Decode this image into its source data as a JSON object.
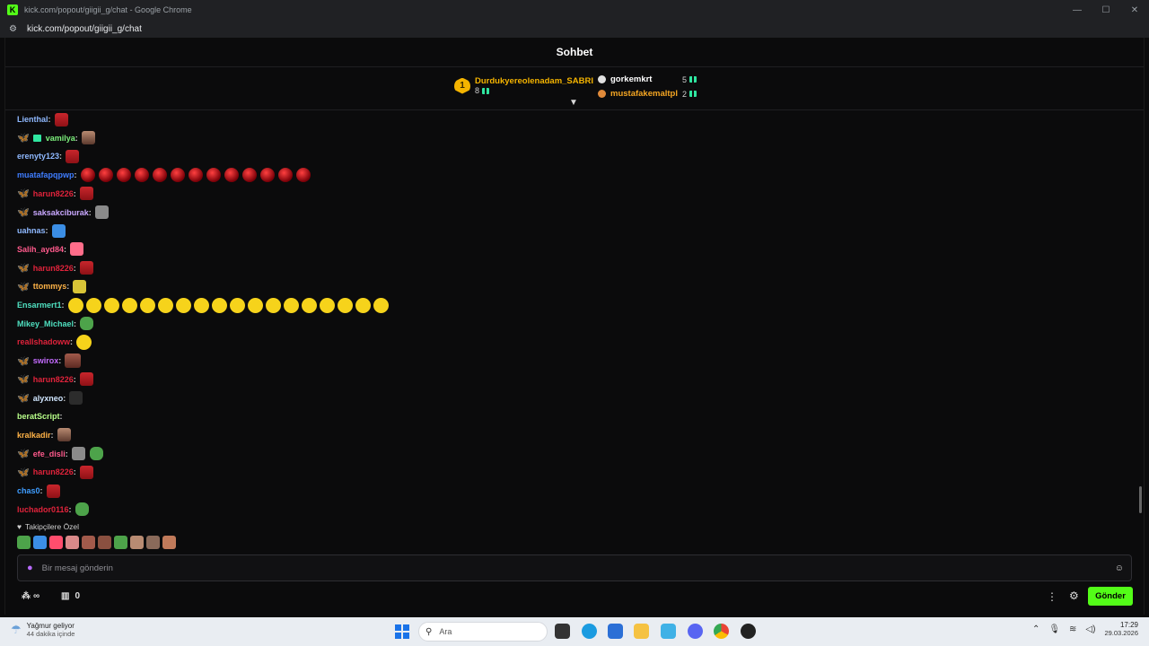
{
  "browser": {
    "window_title": "kick.com/popout/giigii_g/chat - Google Chrome",
    "url": "kick.com/popout/giigii_g/chat",
    "controls": [
      "—",
      "☐",
      "✕"
    ]
  },
  "chat": {
    "title": "Sohbet",
    "leaderboard": {
      "first": {
        "rank": "1",
        "name": "Durdukyereolenadam_SABRI",
        "count": "8",
        "color": "#f5b400"
      },
      "others": [
        {
          "name": "gorkemkrt",
          "count": "5",
          "color": "#ffffff",
          "dot": "#e0e0e0"
        },
        {
          "name": "mustafakemaltpl",
          "count": "2",
          "color": "#f5a623",
          "dot": "#e08a3a"
        }
      ]
    },
    "messages": [
      {
        "user": "Lienthal",
        "color": "#8fb9ff",
        "fly": false,
        "gift": false,
        "emotes": [
          "e-angry"
        ]
      },
      {
        "user": "vamilya",
        "color": "#7cf07c",
        "fly": true,
        "gift": true,
        "emotes": [
          "e-face"
        ]
      },
      {
        "user": "erenyty123",
        "color": "#8fb9ff",
        "fly": false,
        "gift": false,
        "emotes": [
          "e-angry"
        ]
      },
      {
        "user": "muatafapqpwp",
        "color": "#3f7dff",
        "fly": false,
        "gift": false,
        "emotes": [
          "e-ball",
          "e-ball",
          "e-ball",
          "e-ball",
          "e-ball",
          "e-ball",
          "e-ball",
          "e-ball",
          "e-ball",
          "e-ball",
          "e-ball",
          "e-ball",
          "e-ball"
        ]
      },
      {
        "user": "harun8226",
        "color": "#e0233b",
        "fly": true,
        "gift": false,
        "emotes": [
          "e-angry"
        ]
      },
      {
        "user": "saksakciburak",
        "color": "#c9a8ff",
        "fly": true,
        "gift": false,
        "emotes": [
          "e-gray"
        ]
      },
      {
        "user": "uahnas",
        "color": "#8fb9ff",
        "fly": false,
        "gift": false,
        "emotes": [
          "e-blue"
        ]
      },
      {
        "user": "Salih_ayd84",
        "color": "#ff5a8c",
        "fly": false,
        "gift": false,
        "emotes": [
          "e-pink"
        ]
      },
      {
        "user": "harun8226",
        "color": "#e0233b",
        "fly": true,
        "gift": false,
        "emotes": [
          "e-angry"
        ]
      },
      {
        "user": "ttommys",
        "color": "#ffb347",
        "fly": true,
        "gift": false,
        "emotes": [
          "e-yellow"
        ]
      },
      {
        "user": "Ensarmert1",
        "color": "#4fe0c0",
        "fly": false,
        "gift": false,
        "emotes": [
          "e-pac",
          "e-pac",
          "e-pac",
          "e-pac",
          "e-pac",
          "e-pac",
          "e-pac",
          "e-pac",
          "e-pac",
          "e-pac",
          "e-pac",
          "e-pac",
          "e-pac",
          "e-pac",
          "e-pac",
          "e-pac",
          "e-pac",
          "e-pac"
        ]
      },
      {
        "user": "Mikey_Michael",
        "color": "#4fe0c0",
        "fly": false,
        "gift": false,
        "emotes": [
          "e-frog"
        ]
      },
      {
        "user": "reallshadoww",
        "color": "#e0233b",
        "fly": false,
        "gift": false,
        "emotes": [
          "e-pac"
        ]
      },
      {
        "user": "swirox",
        "color": "#c46bff",
        "fly": true,
        "gift": false,
        "emotes": [
          "e-photo"
        ]
      },
      {
        "user": "harun8226",
        "color": "#e0233b",
        "fly": true,
        "gift": false,
        "emotes": [
          "e-angry"
        ]
      },
      {
        "user": "alyxneo",
        "color": "#d0e6ff",
        "fly": true,
        "gift": false,
        "emotes": [
          "e-dark"
        ]
      },
      {
        "user": "beratScript",
        "color": "#b8ff8a",
        "fly": false,
        "gift": false,
        "emotes": []
      },
      {
        "user": "kralkadir",
        "color": "#ffb347",
        "fly": false,
        "gift": false,
        "emotes": [
          "e-face"
        ]
      },
      {
        "user": "efe_disli",
        "color": "#ff5a8c",
        "fly": true,
        "gift": false,
        "emotes": [
          "e-gray",
          "e-frog"
        ]
      },
      {
        "user": "harun8226",
        "color": "#e0233b",
        "fly": true,
        "gift": false,
        "emotes": [
          "e-angry"
        ]
      },
      {
        "user": "chas0",
        "color": "#3f9dff",
        "fly": false,
        "gift": false,
        "emotes": [
          "e-angry"
        ]
      },
      {
        "user": "luchador0116",
        "color": "#e0233b",
        "fly": false,
        "gift": false,
        "emotes": [
          "e-frog"
        ]
      }
    ],
    "subscriber_only_label": "Takipçilere Özel",
    "subscriber_emotes": [
      "#4da34a",
      "#3b8ee5",
      "#ff4d6d",
      "#d98a8a",
      "#a25a4b",
      "#8a5040",
      "#4da34a",
      "#b88b72",
      "#8a6a5a",
      "#c07a5a"
    ],
    "input": {
      "placeholder": "Bir mesaj gönderin",
      "value": ""
    },
    "points": "∞",
    "store_count": "0",
    "send_label": "Gönder"
  },
  "taskbar": {
    "weather_title": "Yağmur geliyor",
    "weather_subtitle": "44 dakika içinde",
    "search_placeholder": "Ara",
    "time": "17:29",
    "date": "29.03.2026"
  },
  "colors": {
    "accent": "#53fc18",
    "background": "#0b0b0c"
  }
}
